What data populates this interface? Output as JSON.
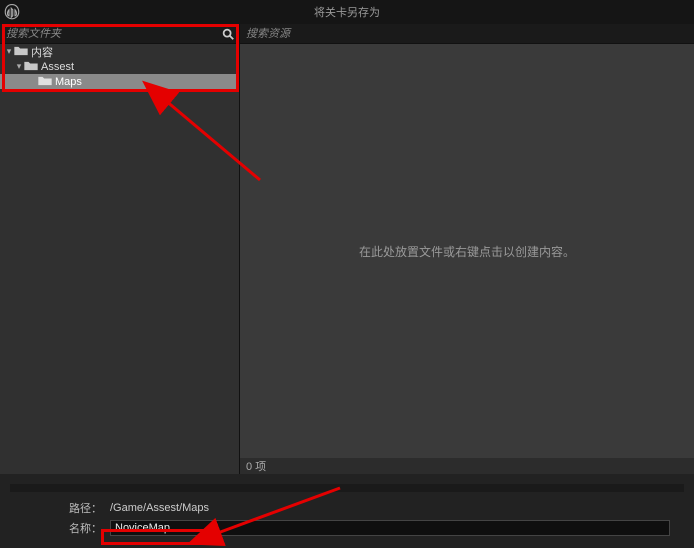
{
  "window": {
    "title": "将关卡另存为"
  },
  "search": {
    "folders_placeholder": "搜索文件夹",
    "assets_placeholder": "搜索资源"
  },
  "tree": {
    "items": [
      {
        "label": "内容",
        "level": 0,
        "expanded": true,
        "hasArrow": true
      },
      {
        "label": "Assest",
        "level": 1,
        "expanded": true,
        "hasArrow": true
      },
      {
        "label": "Maps",
        "level": 2,
        "selected": true,
        "hasArrow": false
      }
    ]
  },
  "assets": {
    "empty_hint": "在此处放置文件或右键点击以创建内容。",
    "count_text": "0 项"
  },
  "footer": {
    "path_label": "路径：",
    "path_value": "/Game/Assest/Maps",
    "name_label": "名称：",
    "name_value": "NoviceMap"
  }
}
